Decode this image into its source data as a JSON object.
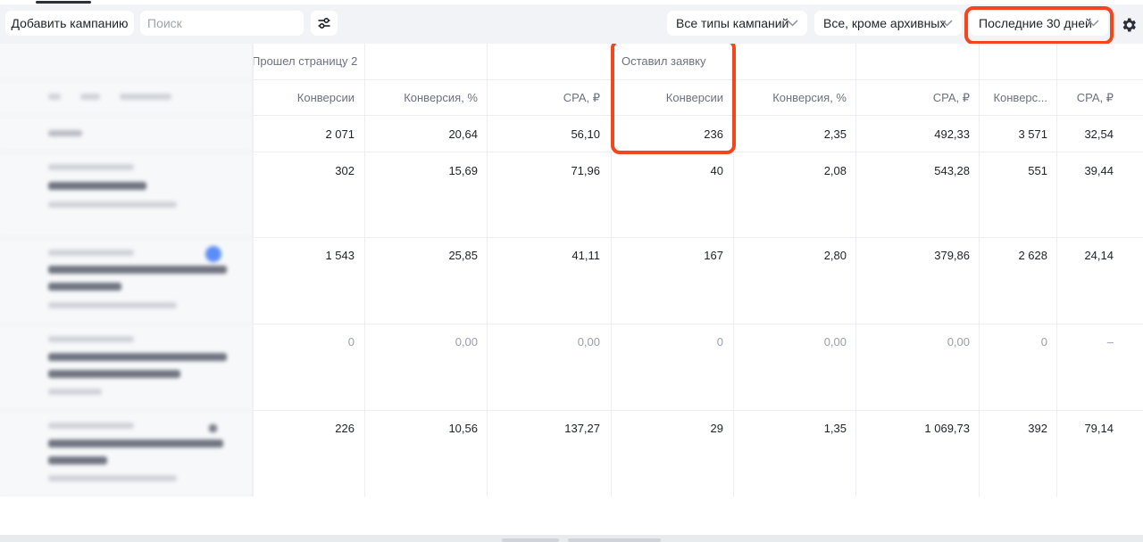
{
  "toolbar": {
    "add_campaign": "Добавить кампанию",
    "search_placeholder": "Поиск",
    "filter_icon": "sliders-icon",
    "campaign_types": "Все типы кампаний",
    "status_filter": "Все, кроме архивных",
    "period": "Последние 30 дней",
    "settings_icon": "gear-icon"
  },
  "colors": {
    "highlight": "#f2461f",
    "accent": "#5c8df6"
  },
  "groups": [
    "Прошел страницу 2",
    "Оставил заявку"
  ],
  "columns": [
    "Конверсии",
    "Конверсия, %",
    "CPA, ₽",
    "Конверсии",
    "Конверсия, %",
    "CPA, ₽",
    "Конверс...",
    "CPA, ₽"
  ],
  "totals": [
    "2 071",
    "20,64",
    "56,10",
    "236",
    "2,35",
    "492,33",
    "3 571",
    "32,54"
  ],
  "rows": [
    [
      "302",
      "15,69",
      "71,96",
      "40",
      "2,08",
      "543,28",
      "551",
      "39,44"
    ],
    [
      "1 543",
      "25,85",
      "41,11",
      "167",
      "2,80",
      "379,86",
      "2 628",
      "24,14"
    ],
    [
      "0",
      "0,00",
      "0,00",
      "0",
      "0,00",
      "0,00",
      "0",
      "–"
    ],
    [
      "226",
      "10,56",
      "137,27",
      "29",
      "1,35",
      "1 069,73",
      "392",
      "79,14"
    ]
  ]
}
